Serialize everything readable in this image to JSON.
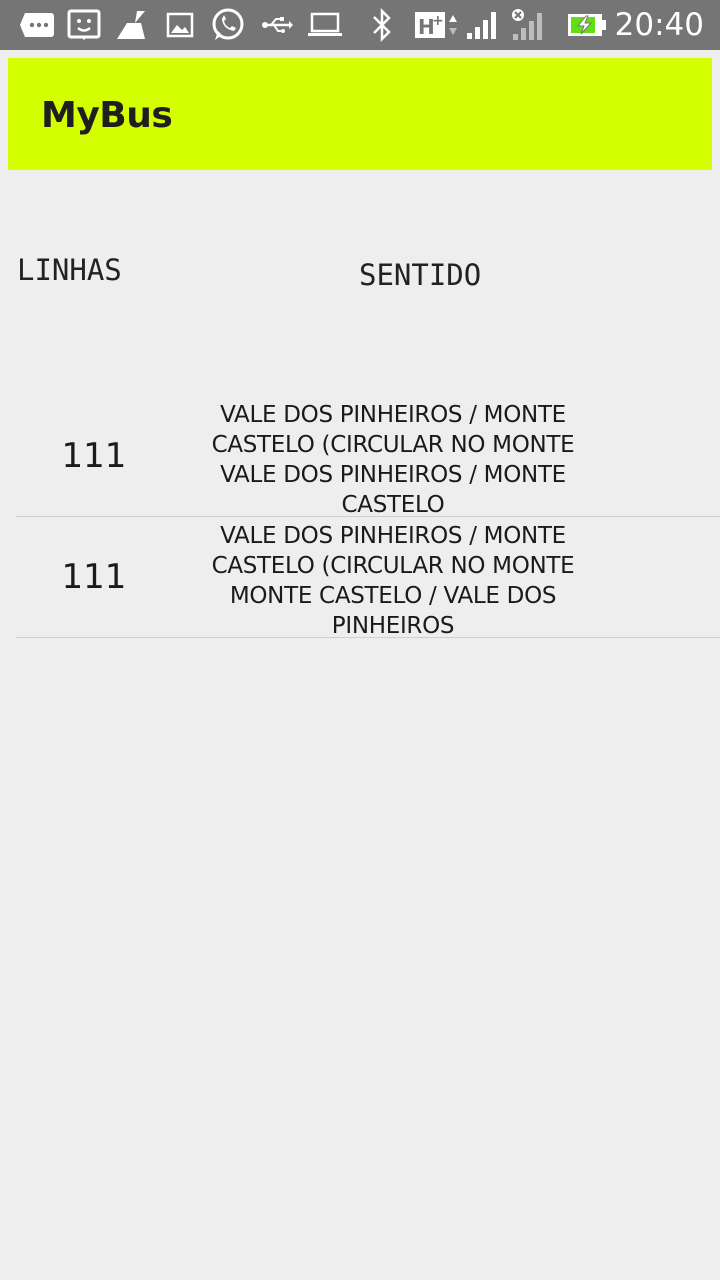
{
  "status_bar": {
    "time": "20:40",
    "icons": [
      "messages-icon",
      "face-icon",
      "cleaner-icon",
      "image-icon",
      "whatsapp-icon",
      "usb-icon",
      "laptop-icon",
      "bluetooth-icon",
      "network-hplus-icon",
      "signal-icon",
      "signal-noservice-icon",
      "battery-charging-icon"
    ],
    "network_label": "H+"
  },
  "app_bar": {
    "title": "MyBus",
    "color": "#d4ff00"
  },
  "table": {
    "headers": {
      "lines": "LINHAS",
      "direction": "SENTIDO"
    },
    "rows": [
      {
        "line": "111",
        "direction_lines": [
          "VALE DOS PINHEIROS / MONTE",
          "CASTELO (CIRCULAR NO MONTE",
          "VALE DOS PINHEIROS / MONTE",
          "CASTELO"
        ]
      },
      {
        "line": "111",
        "direction_lines": [
          "VALE DOS PINHEIROS / MONTE",
          "CASTELO (CIRCULAR NO MONTE",
          "MONTE CASTELO / VALE DOS",
          "PINHEIROS"
        ]
      }
    ]
  }
}
